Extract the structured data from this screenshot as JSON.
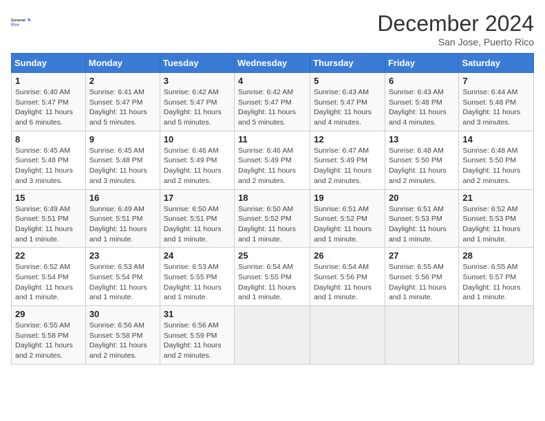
{
  "header": {
    "logo_line1": "General",
    "logo_line2": "Blue",
    "main_title": "December 2024",
    "subtitle": "San Jose, Puerto Rico"
  },
  "days_of_week": [
    "Sunday",
    "Monday",
    "Tuesday",
    "Wednesday",
    "Thursday",
    "Friday",
    "Saturday"
  ],
  "weeks": [
    [
      {
        "day": "1",
        "info": "Sunrise: 6:40 AM\nSunset: 5:47 PM\nDaylight: 11 hours and 6 minutes."
      },
      {
        "day": "2",
        "info": "Sunrise: 6:41 AM\nSunset: 5:47 PM\nDaylight: 11 hours and 5 minutes."
      },
      {
        "day": "3",
        "info": "Sunrise: 6:42 AM\nSunset: 5:47 PM\nDaylight: 11 hours and 5 minutes."
      },
      {
        "day": "4",
        "info": "Sunrise: 6:42 AM\nSunset: 5:47 PM\nDaylight: 11 hours and 5 minutes."
      },
      {
        "day": "5",
        "info": "Sunrise: 6:43 AM\nSunset: 5:47 PM\nDaylight: 11 hours and 4 minutes."
      },
      {
        "day": "6",
        "info": "Sunrise: 6:43 AM\nSunset: 5:48 PM\nDaylight: 11 hours and 4 minutes."
      },
      {
        "day": "7",
        "info": "Sunrise: 6:44 AM\nSunset: 5:48 PM\nDaylight: 11 hours and 3 minutes."
      }
    ],
    [
      {
        "day": "8",
        "info": "Sunrise: 6:45 AM\nSunset: 5:48 PM\nDaylight: 11 hours and 3 minutes."
      },
      {
        "day": "9",
        "info": "Sunrise: 6:45 AM\nSunset: 5:48 PM\nDaylight: 11 hours and 3 minutes."
      },
      {
        "day": "10",
        "info": "Sunrise: 6:46 AM\nSunset: 5:49 PM\nDaylight: 11 hours and 2 minutes."
      },
      {
        "day": "11",
        "info": "Sunrise: 6:46 AM\nSunset: 5:49 PM\nDaylight: 11 hours and 2 minutes."
      },
      {
        "day": "12",
        "info": "Sunrise: 6:47 AM\nSunset: 5:49 PM\nDaylight: 11 hours and 2 minutes."
      },
      {
        "day": "13",
        "info": "Sunrise: 6:48 AM\nSunset: 5:50 PM\nDaylight: 11 hours and 2 minutes."
      },
      {
        "day": "14",
        "info": "Sunrise: 6:48 AM\nSunset: 5:50 PM\nDaylight: 11 hours and 2 minutes."
      }
    ],
    [
      {
        "day": "15",
        "info": "Sunrise: 6:49 AM\nSunset: 5:51 PM\nDaylight: 11 hours and 1 minute."
      },
      {
        "day": "16",
        "info": "Sunrise: 6:49 AM\nSunset: 5:51 PM\nDaylight: 11 hours and 1 minute."
      },
      {
        "day": "17",
        "info": "Sunrise: 6:50 AM\nSunset: 5:51 PM\nDaylight: 11 hours and 1 minute."
      },
      {
        "day": "18",
        "info": "Sunrise: 6:50 AM\nSunset: 5:52 PM\nDaylight: 11 hours and 1 minute."
      },
      {
        "day": "19",
        "info": "Sunrise: 6:51 AM\nSunset: 5:52 PM\nDaylight: 11 hours and 1 minute."
      },
      {
        "day": "20",
        "info": "Sunrise: 6:51 AM\nSunset: 5:53 PM\nDaylight: 11 hours and 1 minute."
      },
      {
        "day": "21",
        "info": "Sunrise: 6:52 AM\nSunset: 5:53 PM\nDaylight: 11 hours and 1 minute."
      }
    ],
    [
      {
        "day": "22",
        "info": "Sunrise: 6:52 AM\nSunset: 5:54 PM\nDaylight: 11 hours and 1 minute."
      },
      {
        "day": "23",
        "info": "Sunrise: 6:53 AM\nSunset: 5:54 PM\nDaylight: 11 hours and 1 minute."
      },
      {
        "day": "24",
        "info": "Sunrise: 6:53 AM\nSunset: 5:55 PM\nDaylight: 11 hours and 1 minute."
      },
      {
        "day": "25",
        "info": "Sunrise: 6:54 AM\nSunset: 5:55 PM\nDaylight: 11 hours and 1 minute."
      },
      {
        "day": "26",
        "info": "Sunrise: 6:54 AM\nSunset: 5:56 PM\nDaylight: 11 hours and 1 minute."
      },
      {
        "day": "27",
        "info": "Sunrise: 6:55 AM\nSunset: 5:56 PM\nDaylight: 11 hours and 1 minute."
      },
      {
        "day": "28",
        "info": "Sunrise: 6:55 AM\nSunset: 5:57 PM\nDaylight: 11 hours and 1 minute."
      }
    ],
    [
      {
        "day": "29",
        "info": "Sunrise: 6:55 AM\nSunset: 5:58 PM\nDaylight: 11 hours and 2 minutes."
      },
      {
        "day": "30",
        "info": "Sunrise: 6:56 AM\nSunset: 5:58 PM\nDaylight: 11 hours and 2 minutes."
      },
      {
        "day": "31",
        "info": "Sunrise: 6:56 AM\nSunset: 5:59 PM\nDaylight: 11 hours and 2 minutes."
      },
      null,
      null,
      null,
      null
    ]
  ]
}
